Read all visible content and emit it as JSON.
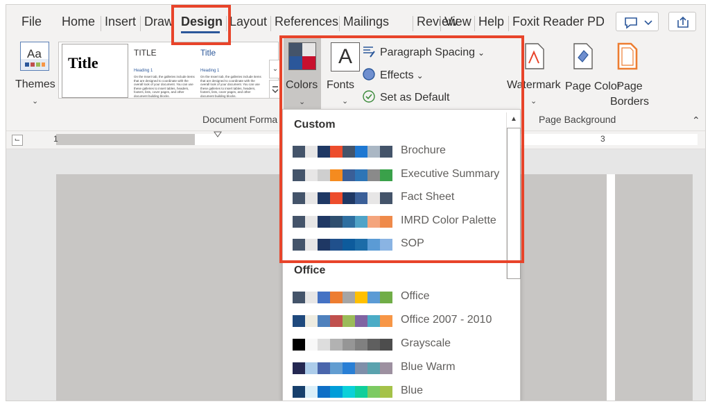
{
  "tabs": [
    "File",
    "Home",
    "Insert",
    "Draw",
    "Design",
    "Layout",
    "References",
    "Mailings",
    "Review",
    "View",
    "Help",
    "Foxit Reader PDF"
  ],
  "active_tab": "Design",
  "ribbon": {
    "themes_label": "Themes",
    "gallery": {
      "tile1_title": "Title",
      "tile2_title": "TITLE",
      "tile2_heading": "Heading 1",
      "tile3_title": "Title",
      "tile3_heading": "Heading 1",
      "tile_body": "On the Insert tab, the galleries include items that are designed to coordinate with the overall look of your document. You can use these galleries to insert tables, headers, footers, lists, cover pages, and other document building blocks."
    },
    "colors_label": "Colors",
    "fonts_label": "Fonts",
    "paragraph_spacing_label": "Paragraph Spacing",
    "effects_label": "Effects",
    "set_default_label": "Set as Default",
    "watermark_label": "Watermark",
    "page_color_label": "Page Color",
    "page_borders_label": "Page Borders",
    "group_document_formatting": "Document Forma",
    "group_page_background": "Page Background"
  },
  "ruler": {
    "left_mark": "1",
    "right_mark": "3"
  },
  "colors_dropdown": {
    "custom_header": "Custom",
    "custom": [
      {
        "name": "Brochure",
        "colors": [
          "#44546a",
          "#e7e6e6",
          "#1f3864",
          "#ed4d2d",
          "#44546a",
          "#1e78d2",
          "#aab7c4",
          "#44546a"
        ]
      },
      {
        "name": "Executive Summary",
        "colors": [
          "#44546a",
          "#e7e6e6",
          "#cfcfcf",
          "#f58b1f",
          "#3a5f98",
          "#2e75b6",
          "#8a8a8a",
          "#3aa14a"
        ]
      },
      {
        "name": "Fact Sheet",
        "colors": [
          "#44546a",
          "#e7e6e6",
          "#1f3864",
          "#ed4d2d",
          "#1f3864",
          "#3a5f98",
          "#e7e6e6",
          "#44546a"
        ]
      },
      {
        "name": "IMRD Color Palette",
        "colors": [
          "#44546a",
          "#e7e6e6",
          "#1f3864",
          "#2f4f6f",
          "#2e6fa0",
          "#4fa3c7",
          "#f4a57d",
          "#ef8a4a"
        ]
      },
      {
        "name": "SOP",
        "colors": [
          "#44546a",
          "#e7e6e6",
          "#1f3864",
          "#20508c",
          "#0d5b9c",
          "#1c6ca8",
          "#5b9bd5",
          "#8ab4e3"
        ]
      }
    ],
    "office_header": "Office",
    "office": [
      {
        "name": "Office",
        "colors": [
          "#44546a",
          "#e7e6e6",
          "#4472c4",
          "#ed7d31",
          "#a5a5a5",
          "#ffc000",
          "#5b9bd5",
          "#70ad47"
        ]
      },
      {
        "name": "Office 2007 - 2010",
        "colors": [
          "#1f497d",
          "#eeece1",
          "#4f81bd",
          "#c0504d",
          "#9bbb59",
          "#8064a2",
          "#4bacc6",
          "#f79646"
        ]
      },
      {
        "name": "Grayscale",
        "colors": [
          "#000000",
          "#f8f8f8",
          "#dddddd",
          "#b2b2b2",
          "#969696",
          "#808080",
          "#5f5f5f",
          "#4d4d4d"
        ]
      },
      {
        "name": "Blue Warm",
        "colors": [
          "#242852",
          "#acccea",
          "#4a66ac",
          "#629dd1",
          "#297fd5",
          "#7f8fa9",
          "#5aa2ae",
          "#9d90a0"
        ]
      },
      {
        "name": "Blue",
        "colors": [
          "#17406d",
          "#dbeff9",
          "#0f6fc6",
          "#009dd9",
          "#0bd0d9",
          "#10cf9b",
          "#7cca62",
          "#a5c249"
        ]
      }
    ]
  },
  "theme_colors": {
    "highlight": "#e8442a",
    "accent": "#2b579a"
  }
}
